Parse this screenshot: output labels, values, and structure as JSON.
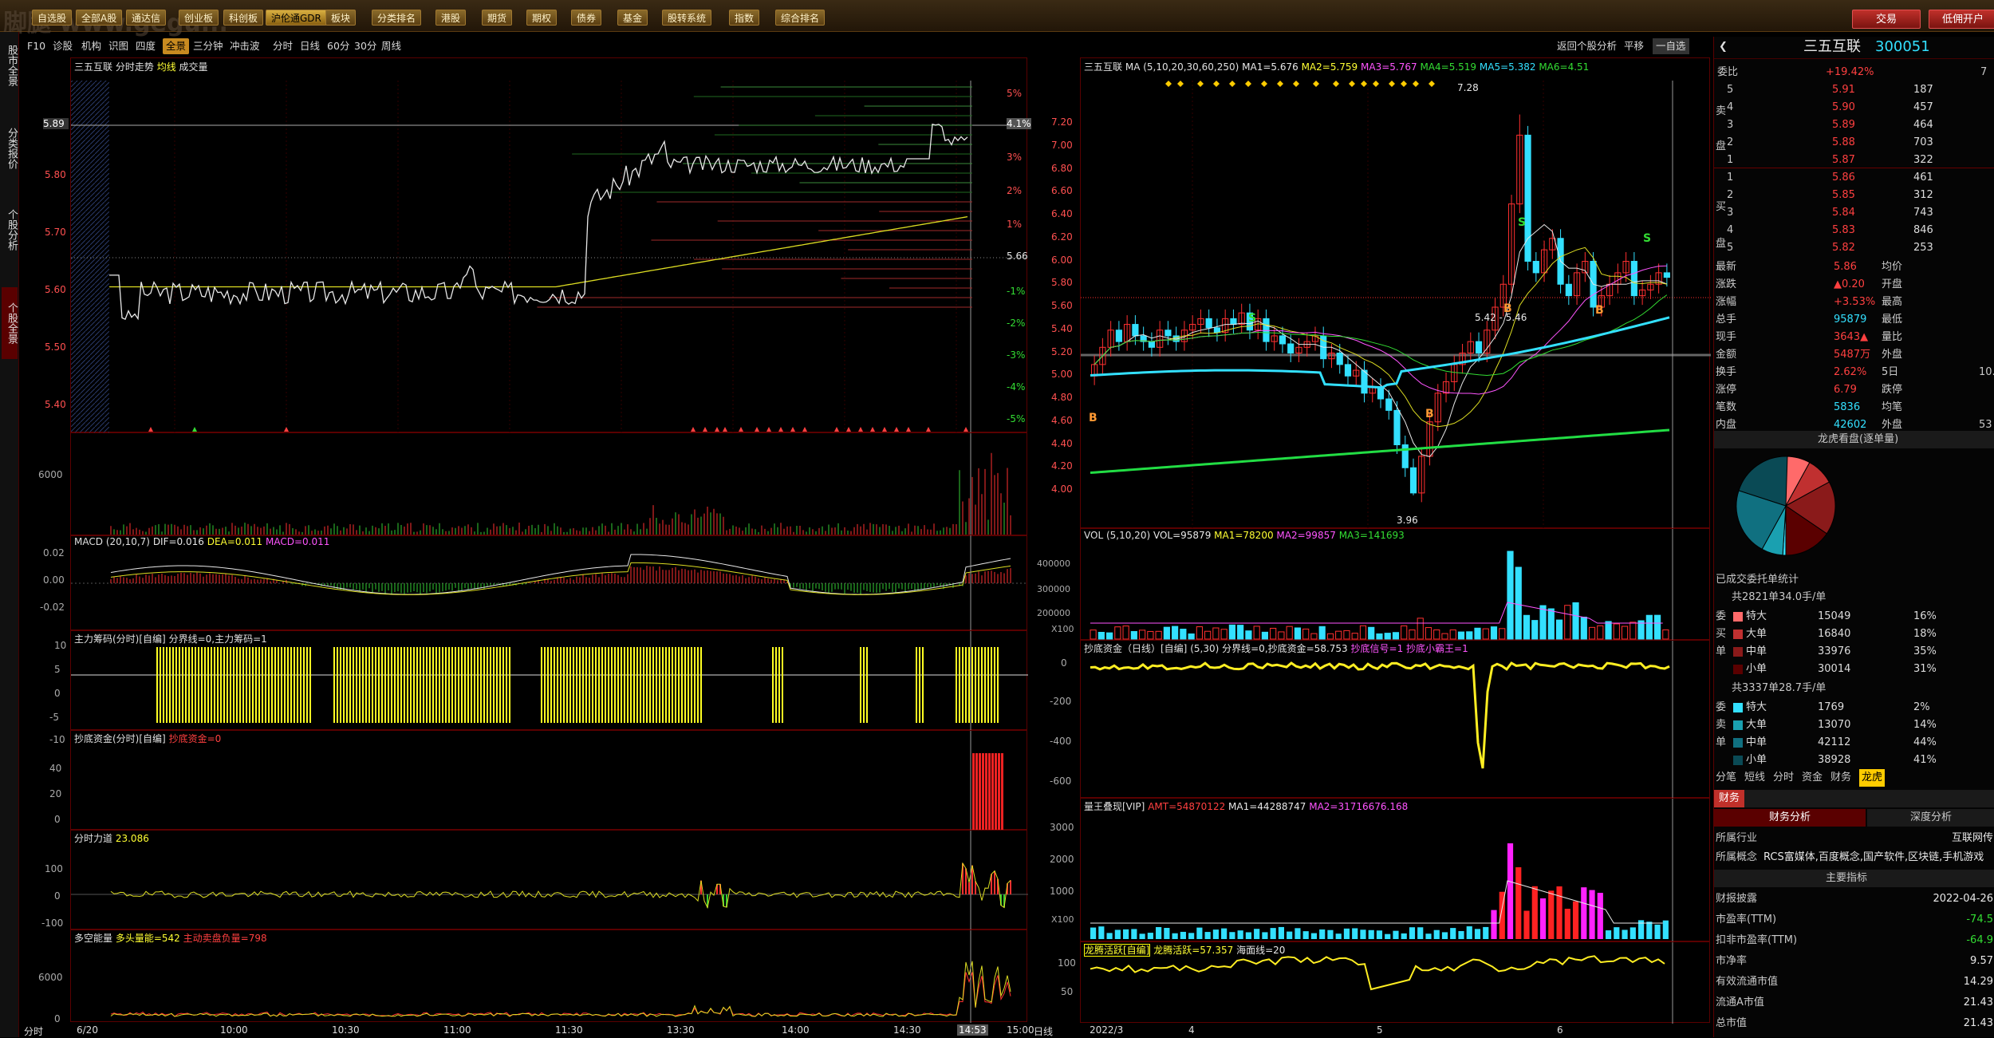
{
  "menu": {
    "watermark": "脚腿 www.gegu...",
    "buttons": [
      "自选股",
      "全部A股",
      "通达信",
      "创业板",
      "科创板",
      "沪伦通GDR",
      "板块",
      "分类排名",
      "港股",
      "期货",
      "期权",
      "债券",
      "基金",
      "股转系统",
      "指数",
      "综合排名"
    ],
    "trade": "交易",
    "margin": "低佣开户"
  },
  "leftnav": [
    "股市全景",
    "分类报价",
    "个股分析",
    "个股全景"
  ],
  "subtabs": [
    "F10",
    "诊股",
    "机构",
    "识图",
    "四度",
    "全景",
    "三分钟",
    "冲击波",
    "分时",
    "日线",
    "60分",
    "30分",
    "周线"
  ],
  "subright": {
    "back": "返回个股分析",
    "flat": "平移",
    "self": "一自选"
  },
  "intraday": {
    "title": "三五互联",
    "label": "分时走势",
    "avg": "均线",
    "vol": "成交量",
    "price_ticks": [
      "5.90",
      "5.80",
      "5.70",
      "5.60",
      "5.50",
      "5.40"
    ],
    "pct_ticks": [
      "5%",
      "4.1%",
      "3%",
      "2%",
      "1%",
      "5.66",
      "-1%",
      "-2%",
      "-3%",
      "-4%",
      "-5%"
    ],
    "cur_price": "5.89",
    "vol_tick": "6000",
    "times": [
      "6/20",
      "10:00",
      "10:30",
      "11:00",
      "11:30",
      "13:30",
      "14:00",
      "14:30",
      "14:53",
      "15:00"
    ],
    "corner": "分时"
  },
  "ind_macd": {
    "name": "MACD",
    "params": "(20,10,7)",
    "dif": "DIF=0.016",
    "dea": "DEA=0.011",
    "macd": "MACD=0.011",
    "ticks": [
      "0.02",
      "0.00",
      "-0.02"
    ]
  },
  "ind_zl": {
    "name": "主力筹码(分时)[自编]",
    "text": "分界线=0,主力筹码=1",
    "ticks": [
      "10",
      "5",
      "0",
      "-5",
      "-10"
    ]
  },
  "ind_cd": {
    "name": "抄底资金(分时)[自编]",
    "text": "抄底资金=0",
    "ticks": [
      "40",
      "20",
      "0"
    ]
  },
  "ind_fs": {
    "name": "分时力道",
    "text": "23.086",
    "ticks": [
      "100",
      "0",
      "-100"
    ]
  },
  "ind_dk": {
    "name": "多空能量",
    "text": "多头量能=542",
    "text2": "主动卖盘负量=798",
    "ticks": [
      "6000",
      "0"
    ]
  },
  "daily": {
    "title": "三五互联",
    "ma": "MA",
    "params": "(5,10,20,30,60,250)",
    "ma1": "MA1=5.676",
    "ma2": "MA2=5.759",
    "ma3": "MA3=5.767",
    "ma4": "MA4=5.519",
    "ma5": "MA5=5.382",
    "ma6": "MA6=4.51",
    "ticks": [
      "7.20",
      "7.00",
      "6.80",
      "6.60",
      "6.40",
      "6.20",
      "6.00",
      "5.80",
      "5.60",
      "5.40",
      "5.20",
      "5.00",
      "4.80",
      "4.60",
      "4.40",
      "4.20",
      "4.00"
    ],
    "high": "7.28",
    "low": "3.96",
    "range": "5.42 - 5.46",
    "dates": [
      "2022/3",
      "4",
      "5",
      "6"
    ],
    "corner": "日线"
  },
  "d_vol": {
    "name": "VOL",
    "params": "(5,10,20)",
    "vol": "VOL=95879",
    "ma1": "MA1=78200",
    "ma2": "MA2=99857",
    "ma3": "MA3=141693",
    "ticks": [
      "400000",
      "300000",
      "200000",
      "100000",
      "X100"
    ]
  },
  "d_cd": {
    "name": "抄底资金（日线）[自编]",
    "params": "(5,30)",
    "text": "分界线=0,抄底资金=58.753",
    "text2": "抄底信号=1",
    "text3": "抄底小霸王=1",
    "ticks": [
      "0",
      "-200",
      "-400",
      "-600"
    ]
  },
  "d_lw": {
    "name": "量王叠现[VIP]",
    "amt": "AMT=54870122",
    "ma1": "MA1=44288747",
    "ma2": "MA2=31716676.168",
    "ticks": [
      "3000",
      "2000",
      "1000",
      "X100"
    ]
  },
  "d_lt": {
    "name": "龙腾活跃[自编]",
    "text": "龙腾活跃=57.357",
    "text2": "海面线=20",
    "ticks": [
      "100",
      "50"
    ]
  },
  "quote": {
    "name": "三五互联",
    "code": "300051",
    "webi": "委比",
    "webi_v": "+19.42%",
    "webi_r": "7",
    "sell": [
      {
        "l": "5",
        "p": "5.91",
        "v": "187"
      },
      {
        "l": "4",
        "p": "5.90",
        "v": "457"
      },
      {
        "l": "3",
        "p": "5.89",
        "v": "464"
      },
      {
        "l": "2",
        "p": "5.88",
        "v": "703"
      },
      {
        "l": "1",
        "p": "5.87",
        "v": "322"
      }
    ],
    "buy": [
      {
        "l": "1",
        "p": "5.86",
        "v": "461"
      },
      {
        "l": "2",
        "p": "5.85",
        "v": "312"
      },
      {
        "l": "3",
        "p": "5.84",
        "v": "743"
      },
      {
        "l": "4",
        "p": "5.83",
        "v": "846"
      },
      {
        "l": "5",
        "p": "5.82",
        "v": "253"
      }
    ],
    "side_sell": "卖",
    "side_pan": "盘",
    "side_buy": "买",
    "stats": [
      {
        "k": "最新",
        "v": "5.86",
        "k2": "均价"
      },
      {
        "k": "涨跌",
        "v": "▲0.20",
        "k2": "开盘"
      },
      {
        "k": "涨幅",
        "v": "+3.53%",
        "k2": "最高"
      },
      {
        "k": "总手",
        "v": "95879",
        "k2": "最低"
      },
      {
        "k": "现手",
        "v": "3643▲",
        "k2": "量比"
      },
      {
        "k": "金额",
        "v": "5487万",
        "k2": "外盘"
      },
      {
        "k": "换手",
        "v": "2.62%",
        "k2": "5日",
        "v2": "10."
      },
      {
        "k": "涨停",
        "v": "6.79",
        "k2": "跌停"
      },
      {
        "k": "笔数",
        "v": "5836",
        "k2": "均笔"
      },
      {
        "k": "内盘",
        "v": "42602",
        "k2": "外盘",
        "v2": "53"
      }
    ],
    "lhk": "龙虎看盘(逐单量)",
    "stat_title": "已成交委托单统计",
    "g1": {
      "title": "共2821单34.0手/单",
      "rows": [
        {
          "n": "特大",
          "v": "15049",
          "p": "16%"
        },
        {
          "n": "大单",
          "v": "16840",
          "p": "18%"
        },
        {
          "n": "中单",
          "v": "33976",
          "p": "35%"
        },
        {
          "n": "小单",
          "v": "30014",
          "p": "31%"
        }
      ],
      "side": [
        "委",
        "买",
        "单"
      ]
    },
    "g2": {
      "title": "共3337单28.7手/单",
      "rows": [
        {
          "n": "特大",
          "v": "1769",
          "p": "2%"
        },
        {
          "n": "大单",
          "v": "13070",
          "p": "14%"
        },
        {
          "n": "中单",
          "v": "42112",
          "p": "44%"
        },
        {
          "n": "小单",
          "v": "38928",
          "p": "41%"
        }
      ],
      "side": [
        "委",
        "卖",
        "单"
      ]
    },
    "tabs": [
      "分笔",
      "短线",
      "分时",
      "资金",
      "财务",
      "龙虎"
    ],
    "fin_tab": "财务",
    "fin_btn": "财务分析",
    "deep_btn": "深度分析",
    "ind": "所属行业",
    "ind_v": "互联网传",
    "concept": "所属概念",
    "concept_v": "RCS富媒体,百度概念,国产软件,区块链,手机游戏",
    "main": "主要指标",
    "fin": [
      {
        "k": "财报披露",
        "v": "2022-04-26"
      },
      {
        "k": "市盈率(TTM)",
        "v": "-74.5"
      },
      {
        "k": "扣非市盈率(TTM)",
        "v": "-64.9"
      },
      {
        "k": "市净率",
        "v": "9.57"
      },
      {
        "k": "有效流通市值",
        "v": "14.29"
      },
      {
        "k": "流通A市值",
        "v": "21.43"
      },
      {
        "k": "总市值",
        "v": "21.43"
      }
    ]
  },
  "colors": {
    "up": "#ff3333",
    "down": "#33e0ff",
    "panel_border": "#5a0000"
  }
}
